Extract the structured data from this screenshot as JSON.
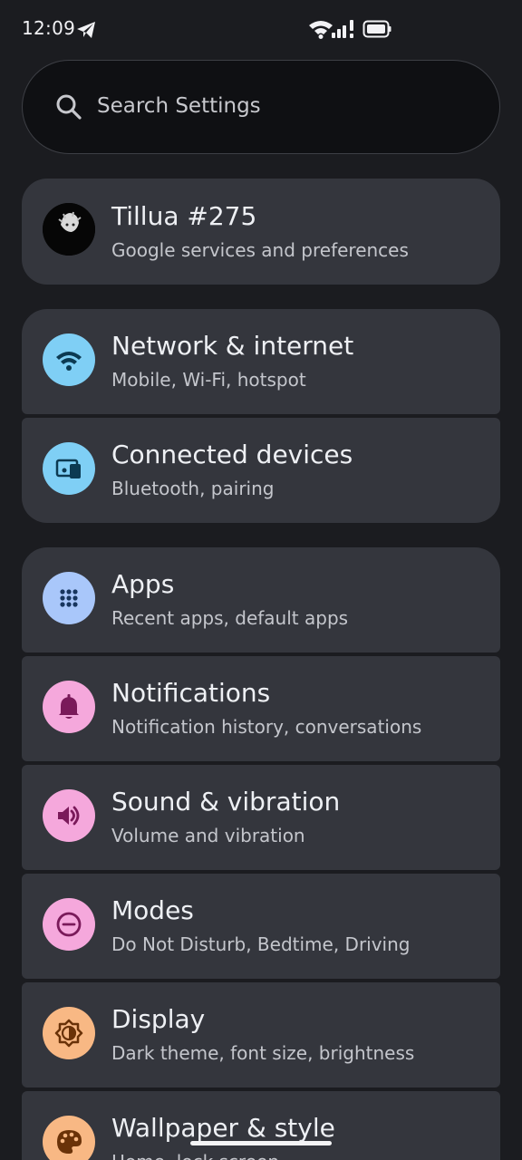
{
  "status_bar": {
    "time": "12:09"
  },
  "search": {
    "placeholder": "Search Settings"
  },
  "account": {
    "name": "Tillua #275",
    "subtitle": "Google services and preferences"
  },
  "items": [
    {
      "title": "Network & internet",
      "subtitle": "Mobile, Wi-Fi, hotspot",
      "icon": "wifi-icon",
      "color": "#7fcff5"
    },
    {
      "title": "Connected devices",
      "subtitle": "Bluetooth, pairing",
      "icon": "connected-devices-icon",
      "color": "#7fcff5"
    },
    {
      "title": "Apps",
      "subtitle": "Recent apps, default apps",
      "icon": "apps-grid-icon",
      "color": "#a9c7fa"
    },
    {
      "title": "Notifications",
      "subtitle": "Notification history, conversations",
      "icon": "bell-icon",
      "color": "#f5a8dc"
    },
    {
      "title": "Sound & vibration",
      "subtitle": "Volume and vibration",
      "icon": "speaker-icon",
      "color": "#f5a8dc"
    },
    {
      "title": "Modes",
      "subtitle": "Do Not Disturb, Bedtime, Driving",
      "icon": "do-not-disturb-icon",
      "color": "#f5a8dc"
    },
    {
      "title": "Display",
      "subtitle": "Dark theme, font size, brightness",
      "icon": "brightness-icon",
      "color": "#f8b884"
    },
    {
      "title": "Wallpaper & style",
      "subtitle": "Home, lock screen",
      "icon": "palette-icon",
      "color": "#f8b884"
    }
  ]
}
